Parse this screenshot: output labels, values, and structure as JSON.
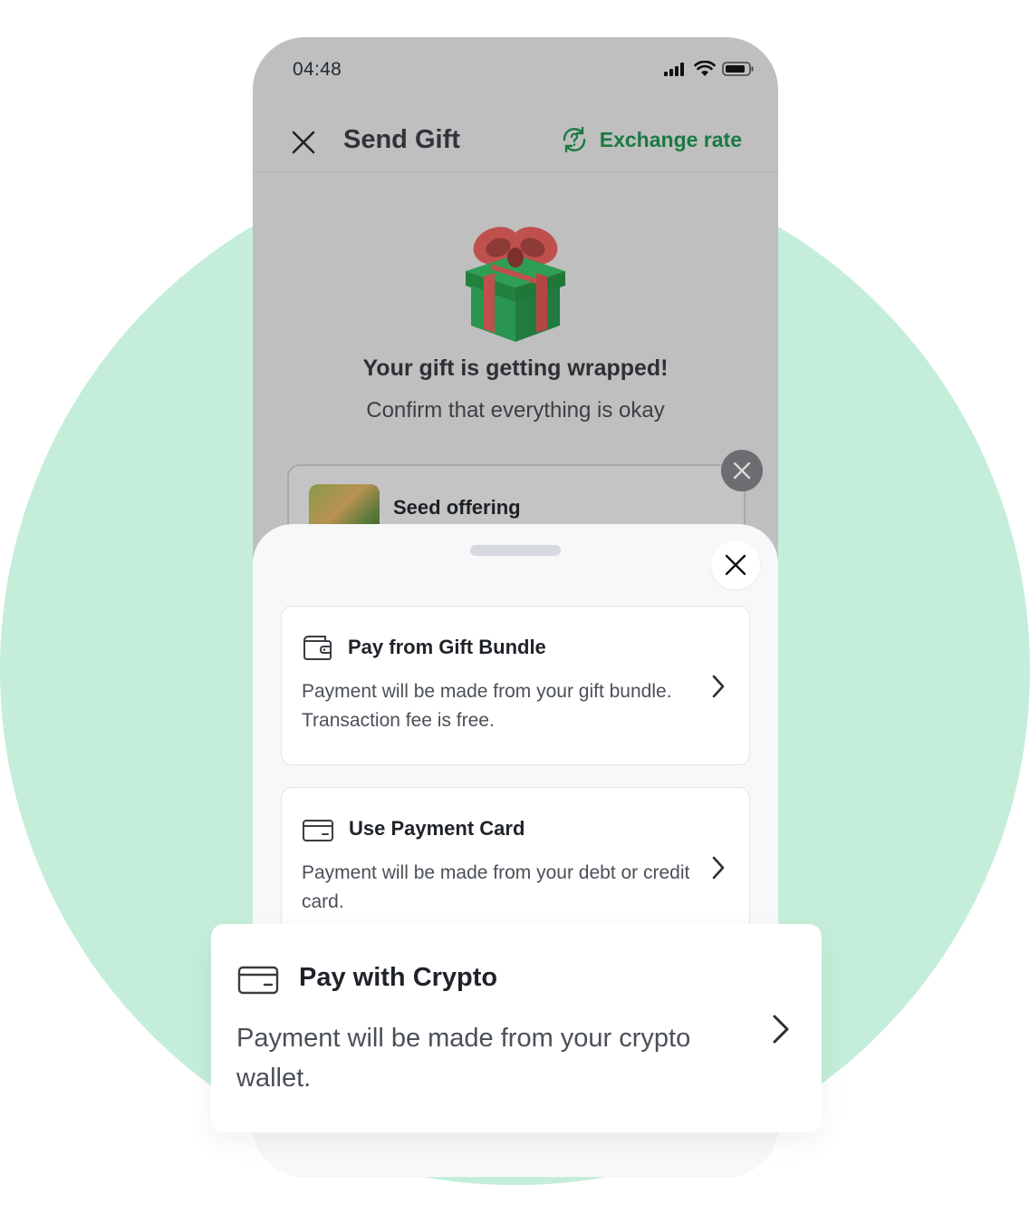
{
  "status_bar": {
    "time": "04:48"
  },
  "header": {
    "title": "Send Gift",
    "exchange_label": "Exchange rate",
    "accent": "#1a7a43"
  },
  "hero": {
    "title": "Your gift is getting wrapped!",
    "subtitle": "Confirm that everything is okay"
  },
  "gift_item": {
    "name": "Seed offering"
  },
  "payment_options": [
    {
      "title": "Pay from Gift Bundle",
      "description": "Payment will be made from your gift bundle. Transaction fee is free.",
      "icon": "wallet-icon"
    },
    {
      "title": "Use Payment Card",
      "description": "Payment will be made from your debt or credit card.",
      "icon": "card-icon"
    }
  ],
  "crypto_option": {
    "title": "Pay with Crypto",
    "description": "Payment will be made from your crypto wallet.",
    "icon": "card-icon"
  },
  "colors": {
    "background_circle": "#c4eed9",
    "overlay": "#bfbfbf",
    "sheet": "#f8f8fa"
  }
}
